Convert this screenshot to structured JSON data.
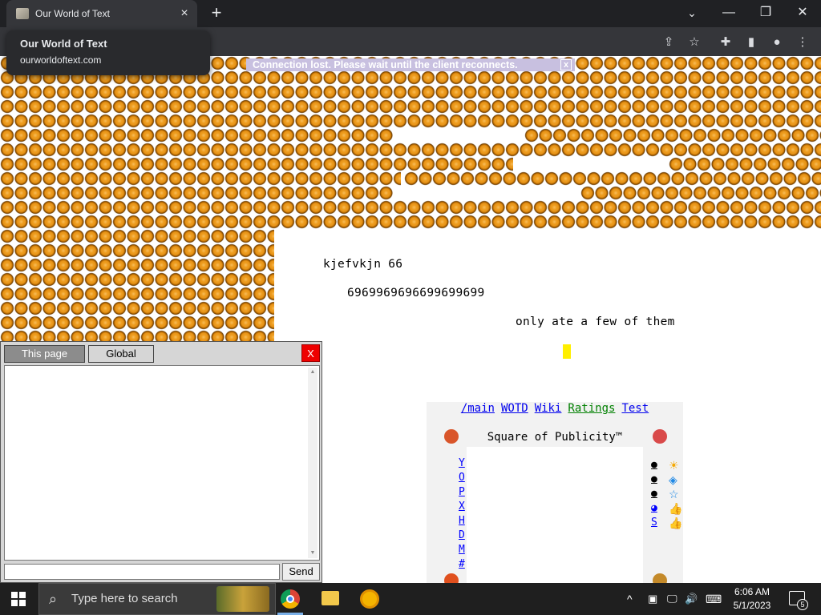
{
  "browser": {
    "tab_title": "Our World of Text",
    "tab_close": "×",
    "new_tab": "+",
    "tooltip_title": "Our World of Text",
    "tooltip_url": "ourworldoftext.com",
    "minimize": "—",
    "restore": "❐",
    "close": "✕",
    "tablist": "⌄"
  },
  "page": {
    "banner": "Connection lost. Please wait until the client reconnects.",
    "banner_close": "x",
    "texts": {
      "line1": "kjefvkjn 66",
      "line2": "6969969696699699699",
      "line3": "only ate a few of them"
    }
  },
  "chat": {
    "tab_active": "This page",
    "tab_inactive": "Global",
    "close": "X",
    "send": "Send",
    "input_value": ""
  },
  "publicity": {
    "links": [
      "/main",
      "WOTD",
      "Wiki",
      "Ratings",
      "Test"
    ],
    "link_colors": [
      "#0000ee",
      "#0000ee",
      "#0000ee",
      "#008000",
      "#0000ee"
    ],
    "title": "Square of Publicity™",
    "left_letters": [
      "Y",
      "O",
      "P",
      "X",
      "H",
      "D",
      "M",
      "#"
    ],
    "right_letters": [
      "●",
      "●",
      "●",
      "◕",
      "S"
    ]
  },
  "taskbar": {
    "search_placeholder": "Type here to search",
    "time": "6:06 AM",
    "date": "5/1/2023",
    "notifications": "5"
  }
}
